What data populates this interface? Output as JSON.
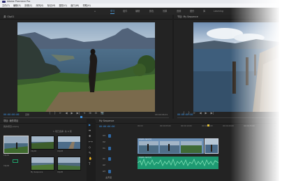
{
  "window": {
    "title": "Adobe Premiere Pro"
  },
  "menu": [
    "文件(F)",
    "编辑(E)",
    "剪辑(C)",
    "序列(S)",
    "标记(M)",
    "图形(G)",
    "窗口(W)",
    "帮助(H)"
  ],
  "workspaces": {
    "tabs": [
      "学习",
      "组件",
      "编辑",
      "颜色",
      "效果",
      "音频",
      "图形",
      "库",
      "Learning"
    ],
    "active_index": 0
  },
  "source_monitor": {
    "title": "源: Clip01",
    "timecode": "00:00:00:00",
    "right_label": "完整",
    "duration": "00:00:06:01"
  },
  "program_monitor": {
    "title": "节目: My Sequence",
    "timecode": "00:00:00:00"
  },
  "transport": {
    "buttons": [
      "{",
      "}",
      "⇤",
      "◀",
      "▶",
      "▶|",
      "⇥",
      "⊞",
      "⊟",
      "📷"
    ]
  },
  "project": {
    "title": "项目: 我的项目",
    "subtitle": "我的项目.prproj",
    "count_label": "1 项已选择, 共 6 项",
    "thumbs": [
      {
        "label": "Clip01"
      },
      {
        "label": "Clip02"
      },
      {
        "label": "Clip03"
      },
      {
        "label": "Clip04"
      },
      {
        "label": "My Sequence"
      },
      {
        "label": "Clip05"
      }
    ]
  },
  "tools": [
    "▶",
    "⇹",
    "✥",
    "⟷",
    "◇",
    "✎",
    "✋",
    "T"
  ],
  "timeline": {
    "title": "My Sequence",
    "timecode": "00:00:00:00",
    "ruler": [
      "00:00",
      "00:00:05:00",
      "00:00:10:00",
      "00:00:15:00",
      "00:00:20:00",
      "00:00:25:00"
    ],
    "tracks": [
      {
        "name": "V3"
      },
      {
        "name": "V2"
      },
      {
        "name": "V1"
      },
      {
        "name": "A1"
      },
      {
        "name": "A2"
      },
      {
        "name": "A3"
      }
    ],
    "clips": {
      "video_1": "Clip01.mp4 [V]",
      "video_2": "Clip02.mp4 [V]",
      "audio_1": "Clip01.mp4 [A]"
    },
    "footer": "主声道"
  }
}
